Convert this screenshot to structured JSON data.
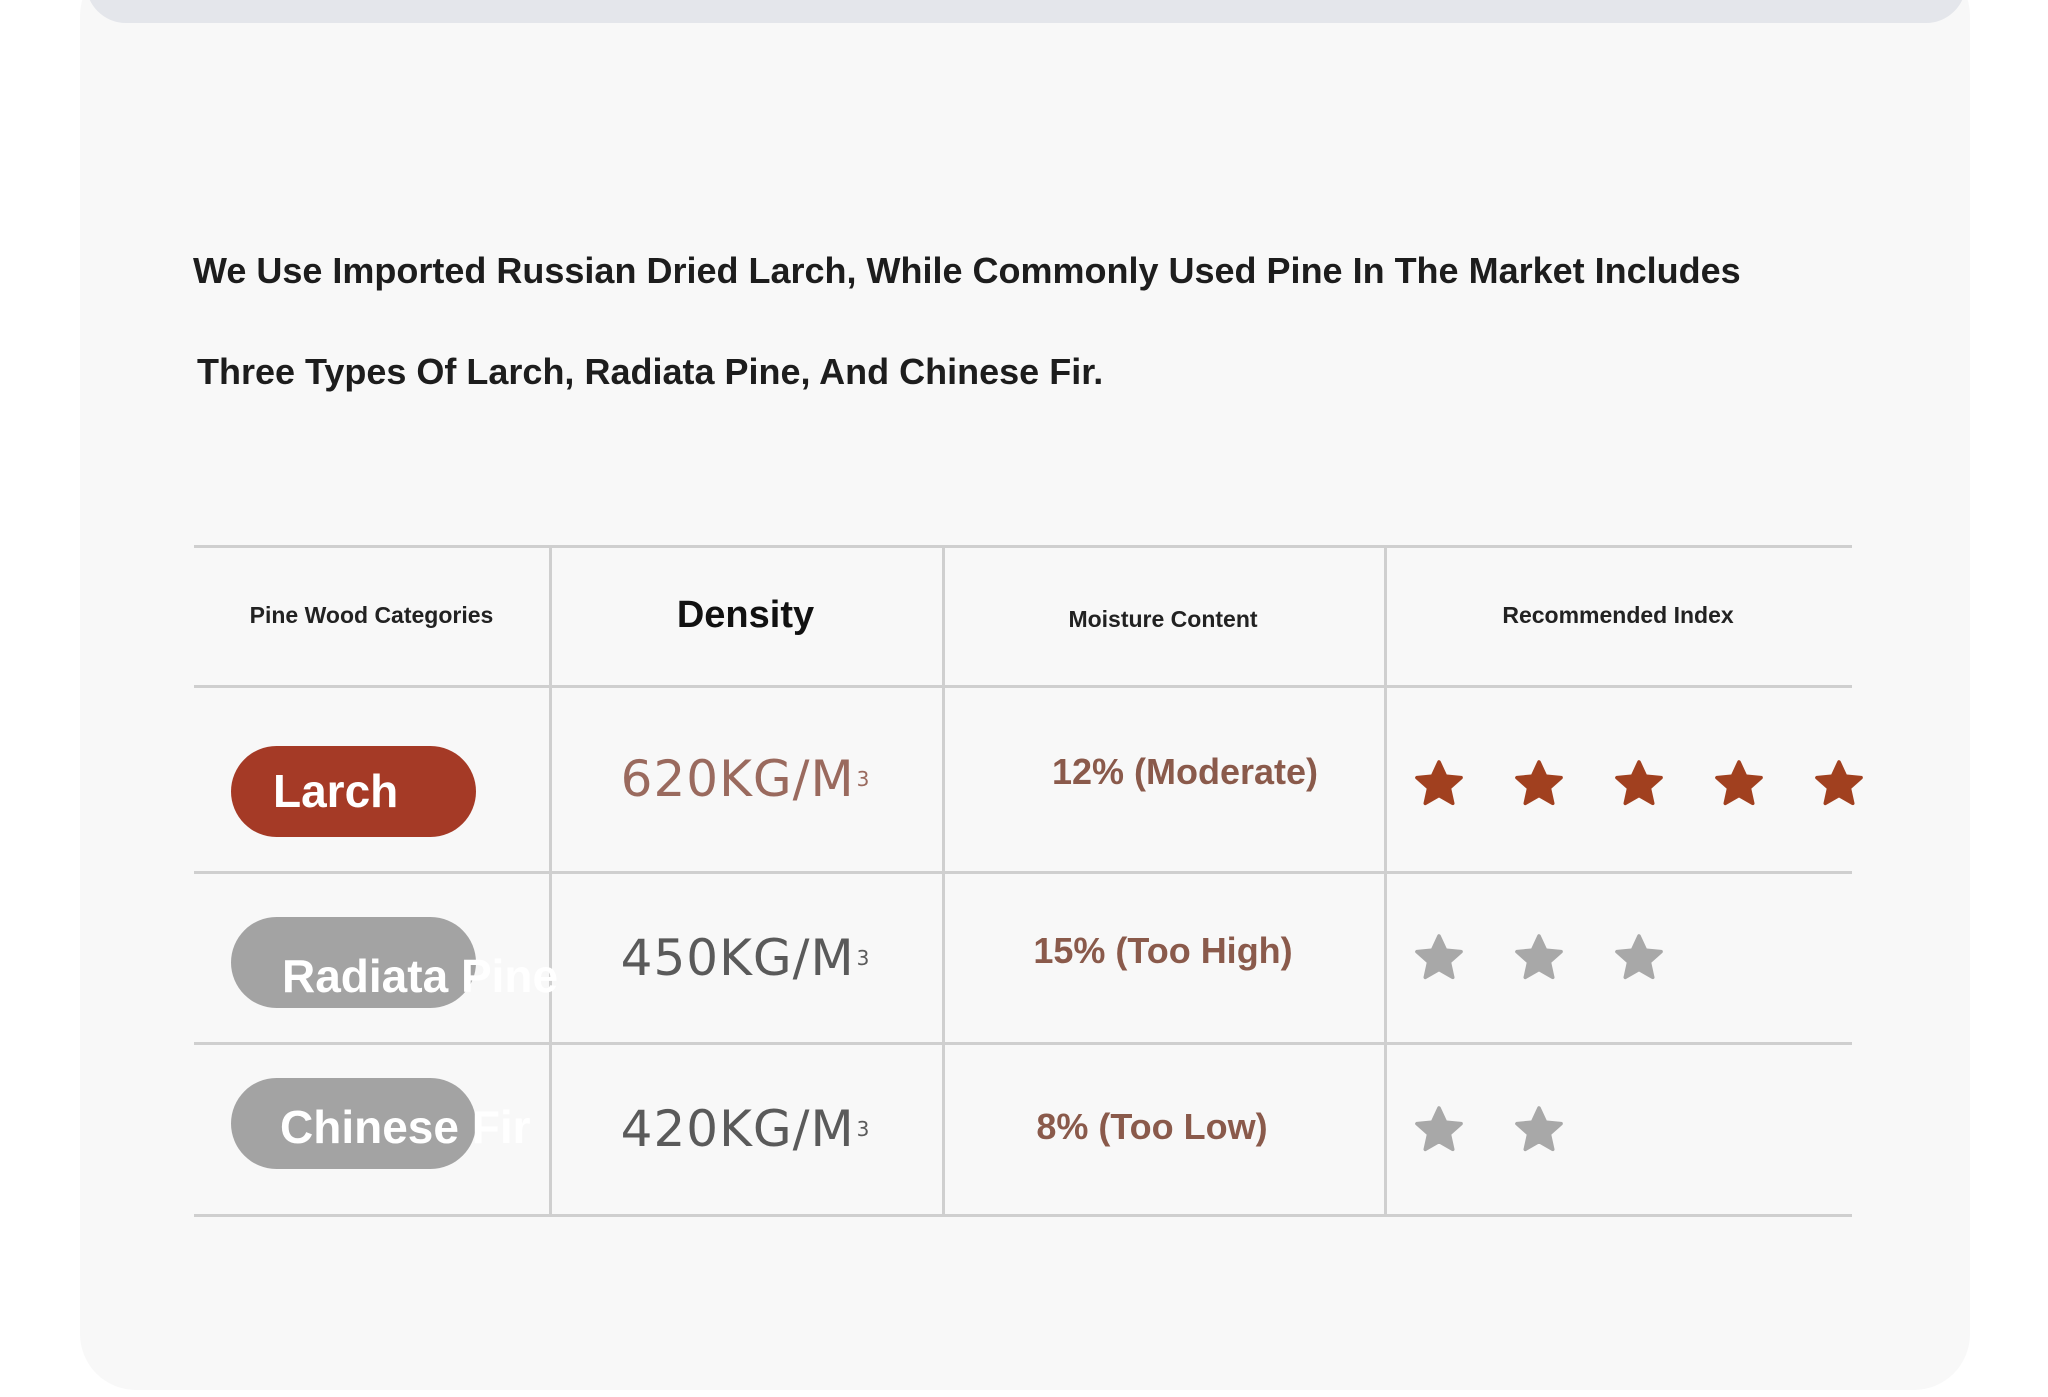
{
  "intro": {
    "line1": "We Use Imported Russian Dried Larch, While Commonly Used Pine In The Market Includes",
    "line2": "Three Types Of Larch, Radiata Pine, And Chinese Fir."
  },
  "table": {
    "headers": {
      "category": "Pine Wood Categories",
      "density": "Density",
      "moisture": "Moisture Content",
      "index": "Recommended Index"
    },
    "rows": [
      {
        "category": "Larch",
        "density": "620KG/M",
        "density_unit_sup": "3",
        "moisture": "12% (Moderate)",
        "rating": 5,
        "rating_max": 5,
        "star_color": "#a1401f",
        "pill_color": "#a53a26"
      },
      {
        "category": "Radiata Pine",
        "density": "450KG/M",
        "density_unit_sup": "3",
        "moisture": "15% (Too High)",
        "rating": 3,
        "rating_max": 5,
        "star_color": "#a8a8a8",
        "pill_color": "#a3a3a3"
      },
      {
        "category": "Chinese Fir",
        "density": "420KG/M",
        "density_unit_sup": "3",
        "moisture": "8% (Too Low)",
        "rating": 2,
        "rating_max": 5,
        "star_color": "#a8a8a8",
        "pill_color": "#a3a3a3"
      }
    ]
  },
  "colors": {
    "accent": "#a53a26",
    "inactive": "#a3a3a3",
    "moisture_text": "#8a5a4b"
  },
  "icons": {
    "rating": "star-icon"
  }
}
